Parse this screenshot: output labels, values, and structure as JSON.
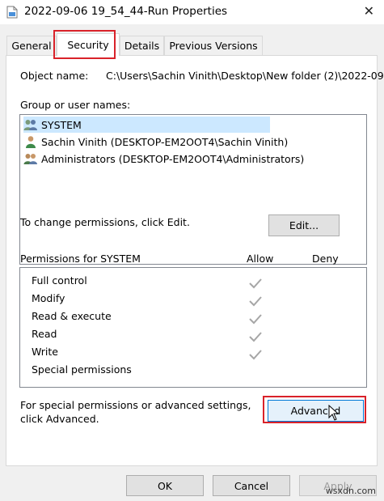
{
  "window": {
    "title": "2022-09-06 19_54_44-Run Properties",
    "close_glyph": "✕"
  },
  "tabs": [
    {
      "label": "General",
      "active": false
    },
    {
      "label": "Security",
      "active": true
    },
    {
      "label": "Details",
      "active": false
    },
    {
      "label": "Previous Versions",
      "active": false
    }
  ],
  "security": {
    "object_name_label": "Object name:",
    "object_name_value": "C:\\Users\\Sachin Vinith\\Desktop\\New folder (2)\\2022-09",
    "group_label": "Group or user names:",
    "users": [
      {
        "name": "SYSTEM",
        "icon": "users-group-icon",
        "selected": true
      },
      {
        "name": "Sachin Vinith (DESKTOP-EM2OOT4\\Sachin Vinith)",
        "icon": "user-icon",
        "selected": false
      },
      {
        "name": "Administrators (DESKTOP-EM2OOT4\\Administrators)",
        "icon": "users-group-icon",
        "selected": false
      }
    ],
    "change_text": "To change permissions, click Edit.",
    "edit_button": "Edit...",
    "permissions_for": "Permissions for SYSTEM",
    "allow_header": "Allow",
    "deny_header": "Deny",
    "permissions": [
      {
        "name": "Full control",
        "allow": true,
        "deny": false
      },
      {
        "name": "Modify",
        "allow": true,
        "deny": false
      },
      {
        "name": "Read & execute",
        "allow": true,
        "deny": false
      },
      {
        "name": "Read",
        "allow": true,
        "deny": false
      },
      {
        "name": "Write",
        "allow": true,
        "deny": false
      },
      {
        "name": "Special permissions",
        "allow": false,
        "deny": false
      }
    ],
    "special_line1": "For special permissions or advanced settings,",
    "special_line2": "click Advanced.",
    "advanced_button": "Advanced"
  },
  "footer": {
    "ok": "OK",
    "cancel": "Cancel",
    "apply": "Apply"
  },
  "watermark": "wsxdn.com",
  "colors": {
    "highlight_border": "#d9222a",
    "selection": "#cce8ff",
    "check_gray": "#a6a6a6"
  }
}
